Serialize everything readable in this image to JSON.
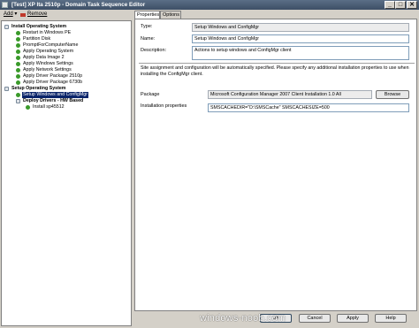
{
  "window": {
    "title": "[Test] XP Ita 2510p - Domain Task Sequence Editor",
    "min_glyph": "_",
    "max_glyph": "□",
    "close_glyph": "✕"
  },
  "toolbar": {
    "add_label": "Add",
    "add_arrow": "▾",
    "remove_label": "Remove"
  },
  "tree": {
    "items": [
      {
        "label": "Install Operating System",
        "bold": true,
        "group": true
      },
      {
        "label": "Restart in Windows PE"
      },
      {
        "label": "Partition Disk"
      },
      {
        "label": "PromptForComputerName"
      },
      {
        "label": "Apply Operating System"
      },
      {
        "label": "Apply Data Image 2"
      },
      {
        "label": "Apply Windows Settings"
      },
      {
        "label": "Apply Network Settings"
      },
      {
        "label": "Apply Driver Package 2510p"
      },
      {
        "label": "Apply Driver Package 6730b"
      },
      {
        "label": "Setup Operating System",
        "bold": true,
        "group": true
      },
      {
        "label": "Setup Windows and ConfigMgr",
        "selected": true
      },
      {
        "label": "Deploy Drivers - HW Based",
        "bold": true,
        "group": true
      },
      {
        "label": "Install sp45512"
      }
    ]
  },
  "tabs": [
    {
      "label": "Properties",
      "active": true
    },
    {
      "label": "Options",
      "active": false
    }
  ],
  "properties": {
    "type_label": "Type:",
    "type_value": "Setup Windows and ConfigMgr",
    "name_label": "Name:",
    "name_value": "Setup Windows and ConfigMgr",
    "description_label": "Description:",
    "description_value": "Actions to setup windows and ConfigMgr client",
    "info_text": "Site assignment and configuration will be automatically specified. Please specify any additional installation properties to use when installing the ConfigMgr client.",
    "package_label": "Package",
    "package_value": "Microsoft Configuration Manager 2007 Client Installation 1.0 All",
    "browse_label": "Browse",
    "install_props_label": "Installation properties",
    "install_props_value": "SMSCACHEDIR=\"D:\\SMSCache\" SMSCACHESIZE=500"
  },
  "footer": {
    "ok_label": "OK",
    "cancel_label": "Cancel",
    "apply_label": "Apply",
    "help_label": "Help"
  },
  "watermark": "windows-noob.com"
}
